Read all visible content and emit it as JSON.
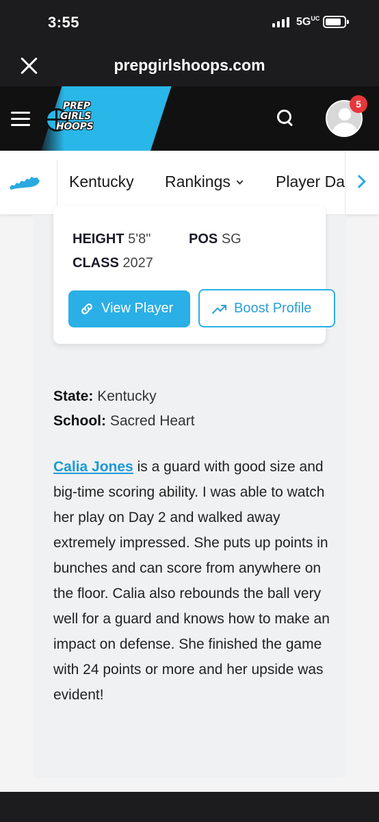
{
  "status_bar": {
    "time": "3:55",
    "network": "5G",
    "network_suffix": "UC"
  },
  "browser": {
    "domain": "prepgirlshoops.com"
  },
  "site_header": {
    "logo_lines": [
      "PREP",
      "GIRLS",
      "HOOPS"
    ],
    "notification_count": "5",
    "colors": {
      "brand_blue": "#29b6e8",
      "header_bg": "#111111",
      "badge_red": "#e5383b"
    }
  },
  "subnav": {
    "items": [
      {
        "label": "Kentucky"
      },
      {
        "label": "Rankings"
      },
      {
        "label": "Player Da"
      }
    ]
  },
  "player_card": {
    "height_label": "HEIGHT",
    "height_value": "5'8\"",
    "pos_label": "POS",
    "pos_value": "SG",
    "class_label": "CLASS",
    "class_value": "2027",
    "view_player_label": "View Player",
    "boost_profile_label": "Boost Profile"
  },
  "meta": {
    "state_label": "State:",
    "state_value": "Kentucky",
    "school_label": "School:",
    "school_value": "Sacred Heart"
  },
  "article": {
    "player_link": "Calia Jones",
    "body": "is a guard with good size and big-time scoring ability. I was able to watch her play on Day 2 and walked away extremely impressed. She puts up points in bunches and can score from anywhere on the floor. Calia also rebounds the ball very well for a guard and knows how to make an impact on defense. She finished the game with 24 points or more and her upside was evident!"
  }
}
